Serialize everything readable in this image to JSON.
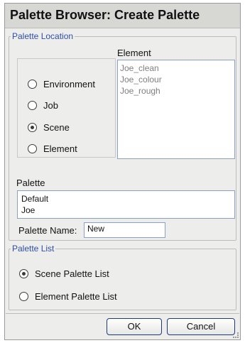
{
  "window": {
    "title": "Palette Browser:  Create Palette"
  },
  "palette_location": {
    "legend": "Palette Location",
    "options": [
      {
        "label": "Environment",
        "checked": false
      },
      {
        "label": "Job",
        "checked": false
      },
      {
        "label": "Scene",
        "checked": true
      },
      {
        "label": "Element",
        "checked": false
      }
    ],
    "element_header": "Element",
    "element_items": [
      "Joe_clean",
      "Joe_colour",
      "Joe_rough"
    ],
    "palette_header": "Palette",
    "palette_items": [
      "Default",
      "Joe"
    ],
    "palette_name_label": "Palette Name:",
    "palette_name_value": "New"
  },
  "palette_list": {
    "legend": "Palette List",
    "options": [
      {
        "label": "Scene Palette List",
        "checked": true
      },
      {
        "label": "Element Palette List",
        "checked": false
      }
    ]
  },
  "buttons": {
    "ok": "OK",
    "cancel": "Cancel"
  }
}
